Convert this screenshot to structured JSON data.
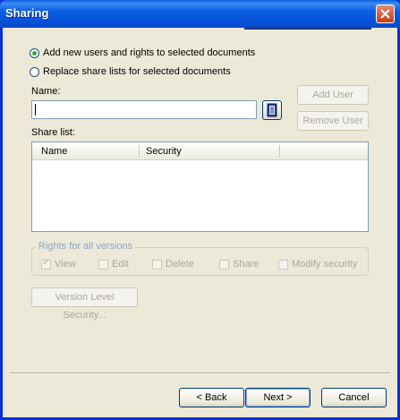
{
  "window": {
    "title": "Sharing"
  },
  "options": {
    "add_new": "Add new users and rights to selected documents",
    "replace": "Replace share lists for selected documents",
    "selected": "add_new"
  },
  "name_field": {
    "label": "Name:",
    "value": ""
  },
  "buttons": {
    "add_user": "Add User",
    "remove_user": "Remove User",
    "version_level_security": "Version Level Security...",
    "back": "< Back",
    "next": "Next >",
    "cancel": "Cancel"
  },
  "share_list": {
    "label": "Share list:",
    "columns": [
      "Name",
      "Security"
    ],
    "rows": []
  },
  "rights": {
    "title": "Rights for all versions",
    "items": [
      {
        "label": "View",
        "checked": true
      },
      {
        "label": "Edit",
        "checked": false
      },
      {
        "label": "Delete",
        "checked": false
      },
      {
        "label": "Share",
        "checked": false
      },
      {
        "label": "Modify security",
        "checked": false
      }
    ]
  }
}
